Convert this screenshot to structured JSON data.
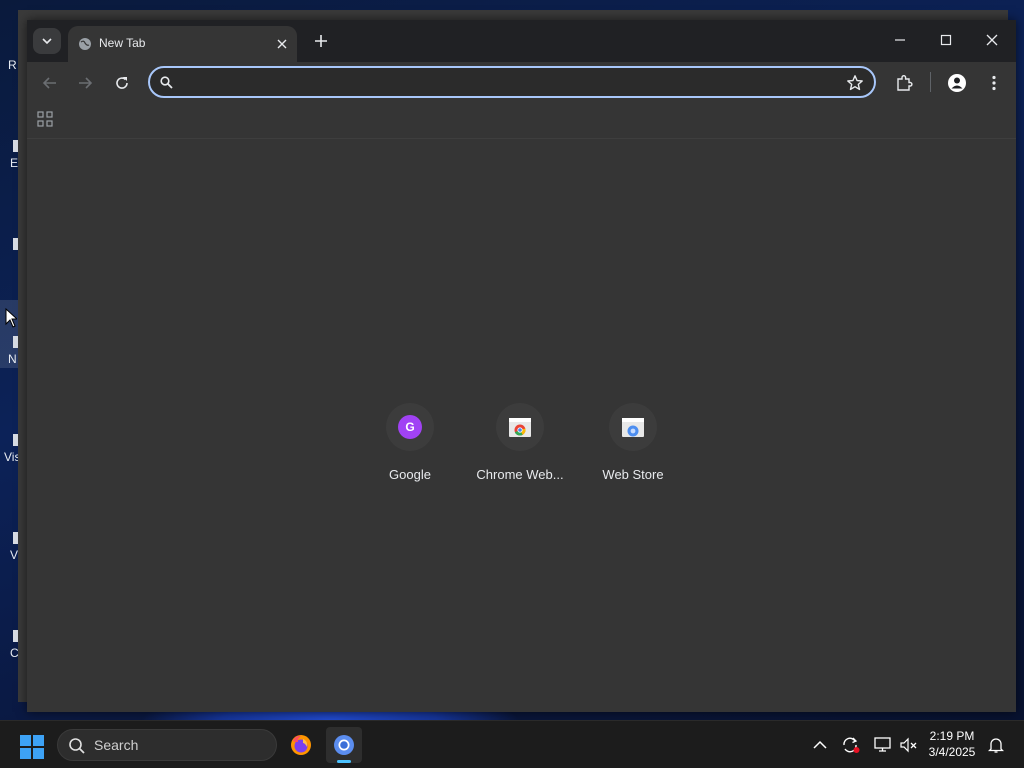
{
  "desktop": {
    "icon_labels": [
      "R",
      "E",
      "N",
      "Vis",
      "V",
      "C"
    ]
  },
  "browser": {
    "tab": {
      "title": "New Tab"
    },
    "omnibox": {
      "value": "",
      "placeholder": ""
    },
    "shortcuts": [
      {
        "label": "Google",
        "icon_letter": "G",
        "icon": "google-letter-icon",
        "color": "#a142f4"
      },
      {
        "label": "Chrome Web...",
        "icon": "chrome-web-store-icon"
      },
      {
        "label": "Web Store",
        "icon": "web-store-icon"
      }
    ]
  },
  "taskbar": {
    "search_label": "Search",
    "clock": {
      "time": "2:19 PM",
      "date": "3/4/2025"
    }
  },
  "colors": {
    "accent": "#a8c7fa",
    "window_bg": "#353535",
    "titlebar_bg": "#202124",
    "taskbar_bg": "#1c1c1c",
    "active_indicator": "#4cc2ff"
  }
}
